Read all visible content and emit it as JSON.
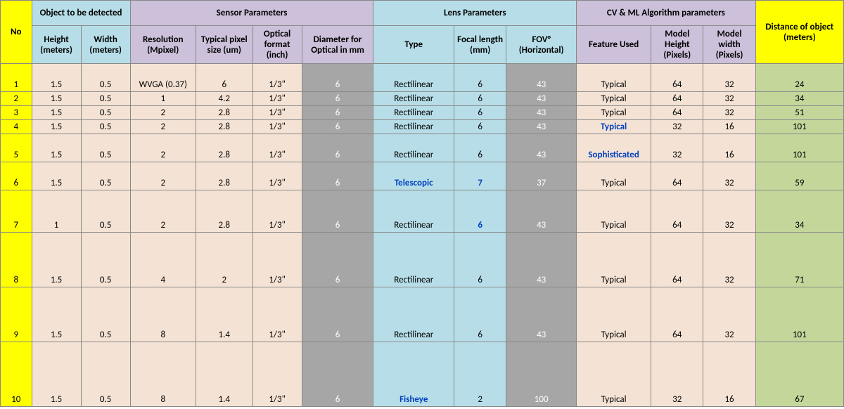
{
  "headers": {
    "groups": {
      "object": "Object to be detected",
      "sensor": "Sensor Parameters",
      "lens": "Lens Parameters",
      "cvml": "CV & ML Algorithm parameters"
    },
    "cols": {
      "no": "No",
      "height": "Height (meters)",
      "width": "Width (meters)",
      "resolution": "Resolution (Mpixel)",
      "pixel": "Typical pixel size (um)",
      "format": "Optical format (inch)",
      "diameter": "Diameter for Optical in mm",
      "type": "Type",
      "focal": "Focal length (mm)",
      "fov": "FOV° (Horizontal)",
      "feature": "Feature Used",
      "model_h": "Model Height (Pixels)",
      "model_w": "Model width (Pixels)",
      "distance": "Distance of object (meters)"
    }
  },
  "rows": [
    {
      "no": "1",
      "rh": "rh-m",
      "height": "1.5",
      "width": "0.5",
      "resolution": "WVGA (0.37)",
      "pixel": "6",
      "format": "1/3\"",
      "diameter": "6",
      "type": "Rectilinear",
      "type_bold": false,
      "focal": "6",
      "focal_bold": false,
      "fov": "43",
      "feature": "Typical",
      "feature_bold": false,
      "model_h": "64",
      "model_w": "32",
      "distance": "24"
    },
    {
      "no": "2",
      "rh": "rh-s",
      "height": "1.5",
      "width": "0.5",
      "resolution": "1",
      "pixel": "4.2",
      "format": "1/3\"",
      "diameter": "6",
      "type": "Rectilinear",
      "type_bold": false,
      "focal": "6",
      "focal_bold": false,
      "fov": "43",
      "feature": "Typical",
      "feature_bold": false,
      "model_h": "64",
      "model_w": "32",
      "distance": "34"
    },
    {
      "no": "3",
      "rh": "rh-s",
      "height": "1.5",
      "width": "0.5",
      "resolution": "2",
      "pixel": "2.8",
      "format": "1/3\"",
      "diameter": "6",
      "type": "Rectilinear",
      "type_bold": false,
      "focal": "6",
      "focal_bold": false,
      "fov": "43",
      "feature": "Typical",
      "feature_bold": false,
      "model_h": "64",
      "model_w": "32",
      "distance": "51"
    },
    {
      "no": "4",
      "rh": "rh-s",
      "height": "1.5",
      "width": "0.5",
      "resolution": "2",
      "pixel": "2.8",
      "format": "1/3\"",
      "diameter": "6",
      "type": "Rectilinear",
      "type_bold": false,
      "focal": "6",
      "focal_bold": false,
      "fov": "43",
      "feature": "Typical",
      "feature_bold": true,
      "model_h": "32",
      "model_w": "16",
      "distance": "101"
    },
    {
      "no": "5",
      "rh": "rh-m",
      "height": "1.5",
      "width": "0.5",
      "resolution": "2",
      "pixel": "2.8",
      "format": "1/3\"",
      "diameter": "6",
      "type": "Rectilinear",
      "type_bold": false,
      "focal": "6",
      "focal_bold": false,
      "fov": "43",
      "feature": "Sophisticated",
      "feature_bold": true,
      "model_h": "32",
      "model_w": "16",
      "distance": "101"
    },
    {
      "no": "6",
      "rh": "rh-m",
      "height": "1.5",
      "width": "0.5",
      "resolution": "2",
      "pixel": "2.8",
      "format": "1/3\"",
      "diameter": "6",
      "type": "Telescopic",
      "type_bold": true,
      "focal": "7",
      "focal_bold": true,
      "fov": "37",
      "feature": "Typical",
      "feature_bold": false,
      "model_h": "64",
      "model_w": "32",
      "distance": "59"
    },
    {
      "no": "7",
      "rh": "rh-l",
      "height": "1",
      "width": "0.5",
      "resolution": "2",
      "pixel": "2.8",
      "format": "1/3\"",
      "diameter": "6",
      "type": "Rectilinear",
      "type_bold": false,
      "focal": "6",
      "focal_bold": true,
      "fov": "43",
      "feature": "Typical",
      "feature_bold": false,
      "model_h": "64",
      "model_w": "32",
      "distance": "34"
    },
    {
      "no": "8",
      "rh": "rh-xl",
      "height": "1.5",
      "width": "0.5",
      "resolution": "4",
      "pixel": "2",
      "format": "1/3\"",
      "diameter": "6",
      "type": "Rectilinear",
      "type_bold": false,
      "focal": "6",
      "focal_bold": false,
      "fov": "43",
      "feature": "Typical",
      "feature_bold": false,
      "model_h": "64",
      "model_w": "32",
      "distance": "71"
    },
    {
      "no": "9",
      "rh": "rh-xl",
      "height": "1.5",
      "width": "0.5",
      "resolution": "8",
      "pixel": "1.4",
      "format": "1/3\"",
      "diameter": "6",
      "type": "Rectilinear",
      "type_bold": false,
      "focal": "6",
      "focal_bold": false,
      "fov": "43",
      "feature": "Typical",
      "feature_bold": false,
      "model_h": "64",
      "model_w": "32",
      "distance": "101"
    },
    {
      "no": "10",
      "rh": "rh-xxl",
      "height": "1.5",
      "width": "0.5",
      "resolution": "8",
      "pixel": "1.4",
      "format": "1/3\"",
      "diameter": "6",
      "type": "Fisheye",
      "type_bold": true,
      "focal": "2",
      "focal_bold": false,
      "fov": "100",
      "feature": "Typical",
      "feature_bold": false,
      "model_h": "32",
      "model_w": "16",
      "distance": "67"
    }
  ],
  "chart_data": {
    "type": "table",
    "title": "Object detection distance vs sensor, lens, and CV/ML parameters",
    "columns": [
      "No",
      "Height (meters)",
      "Width (meters)",
      "Resolution (Mpixel)",
      "Typical pixel size (um)",
      "Optical format (inch)",
      "Diameter for Optical in mm",
      "Type",
      "Focal length (mm)",
      "FOV° (Horizontal)",
      "Feature Used",
      "Model Height (Pixels)",
      "Model width (Pixels)",
      "Distance of object (meters)"
    ],
    "rows": [
      [
        1,
        1.5,
        0.5,
        "WVGA (0.37)",
        6,
        "1/3\"",
        6,
        "Rectilinear",
        6,
        43,
        "Typical",
        64,
        32,
        24
      ],
      [
        2,
        1.5,
        0.5,
        1,
        4.2,
        "1/3\"",
        6,
        "Rectilinear",
        6,
        43,
        "Typical",
        64,
        32,
        34
      ],
      [
        3,
        1.5,
        0.5,
        2,
        2.8,
        "1/3\"",
        6,
        "Rectilinear",
        6,
        43,
        "Typical",
        64,
        32,
        51
      ],
      [
        4,
        1.5,
        0.5,
        2,
        2.8,
        "1/3\"",
        6,
        "Rectilinear",
        6,
        43,
        "Typical",
        32,
        16,
        101
      ],
      [
        5,
        1.5,
        0.5,
        2,
        2.8,
        "1/3\"",
        6,
        "Rectilinear",
        6,
        43,
        "Sophisticated",
        32,
        16,
        101
      ],
      [
        6,
        1.5,
        0.5,
        2,
        2.8,
        "1/3\"",
        6,
        "Telescopic",
        7,
        37,
        "Typical",
        64,
        32,
        59
      ],
      [
        7,
        1,
        0.5,
        2,
        2.8,
        "1/3\"",
        6,
        "Rectilinear",
        6,
        43,
        "Typical",
        64,
        32,
        34
      ],
      [
        8,
        1.5,
        0.5,
        4,
        2,
        "1/3\"",
        6,
        "Rectilinear",
        6,
        43,
        "Typical",
        64,
        32,
        71
      ],
      [
        9,
        1.5,
        0.5,
        8,
        1.4,
        "1/3\"",
        6,
        "Rectilinear",
        6,
        43,
        "Typical",
        64,
        32,
        101
      ],
      [
        10,
        1.5,
        0.5,
        8,
        1.4,
        "1/3\"",
        6,
        "Fisheye",
        2,
        100,
        "Typical",
        32,
        16,
        67
      ]
    ]
  }
}
